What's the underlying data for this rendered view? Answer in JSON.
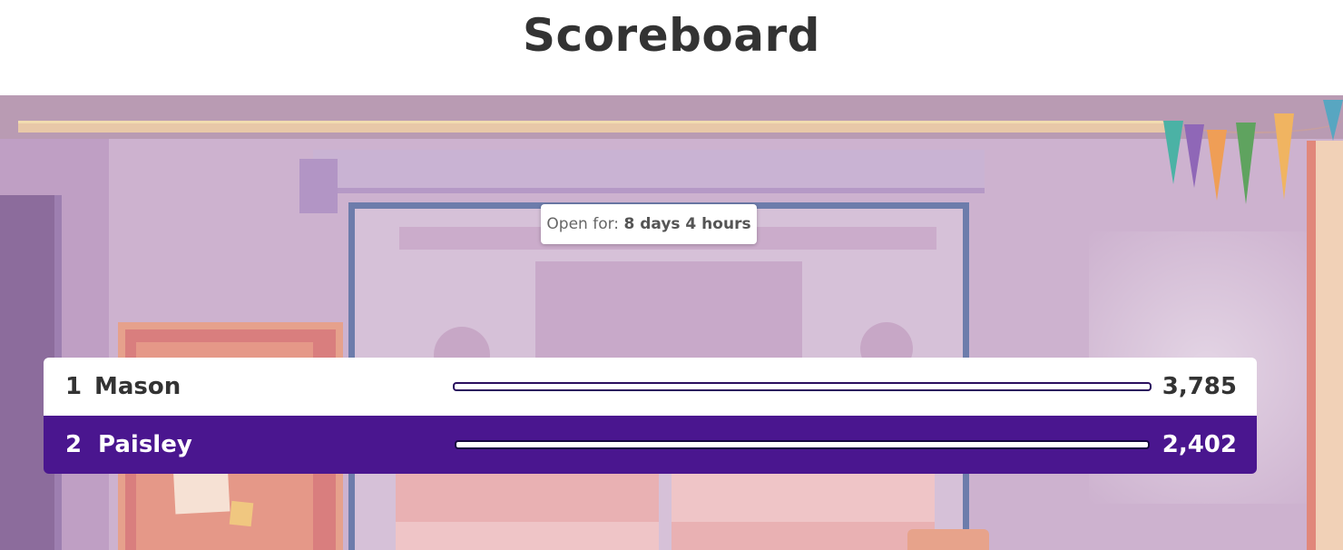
{
  "header": {
    "title": "Scoreboard"
  },
  "timer": {
    "label": "Open for:",
    "value": "8 days 4 hours"
  },
  "leaderboard": [
    {
      "rank": "1",
      "name": "Mason",
      "score": "3,785",
      "progress": 1.0
    },
    {
      "rank": "2",
      "name": "Paisley",
      "score": "2,402",
      "progress": 1.0
    }
  ],
  "colors": {
    "highlight_row": "#4a168f",
    "title_text": "#333333"
  }
}
